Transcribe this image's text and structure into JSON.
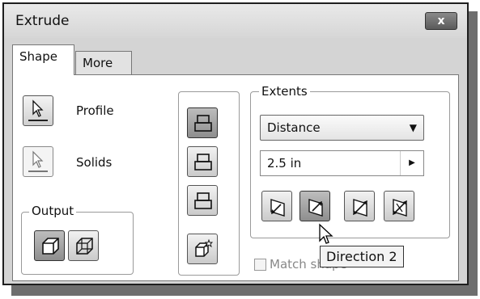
{
  "window": {
    "title": "Extrude",
    "close_label": "x"
  },
  "tabs": [
    {
      "label": "Shape",
      "active": true
    },
    {
      "label": "More",
      "active": false
    }
  ],
  "selection": {
    "profile_label": "Profile",
    "solids_label": "Solids"
  },
  "output": {
    "group_label": "Output",
    "buttons": [
      "solid-output-icon",
      "surface-output-icon"
    ]
  },
  "operation_buttons": [
    "join-icon",
    "cut-icon",
    "intersect-icon",
    "new-solid-icon"
  ],
  "extents": {
    "group_label": "Extents",
    "type_value": "Distance",
    "distance_value": "2.5 in",
    "direction_buttons": [
      "direction-1-icon",
      "direction-2-icon",
      "symmetric-icon",
      "asymmetric-icon"
    ]
  },
  "match_shape": {
    "label": "Match shape",
    "checked": false
  },
  "tooltip": {
    "text": "Direction 2"
  }
}
